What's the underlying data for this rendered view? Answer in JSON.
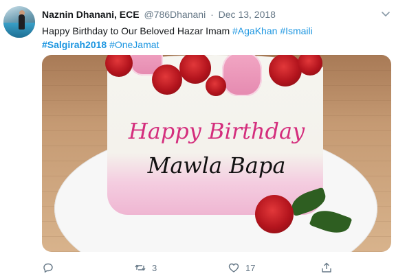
{
  "tweet": {
    "display_name": "Naznin Dhanani, ECE",
    "handle": "@786Dhanani",
    "separator": "·",
    "date": "Dec 13, 2018",
    "text_plain": "Happy Birthday to Our Beloved Hazar Imam",
    "hashtags": [
      "#AgaKhan",
      "#Ismaili",
      "#Salgirah2018",
      "#OneJamat"
    ],
    "media": {
      "cake_text_line1": "Happy Birthday",
      "cake_text_line2": "Mawla Bapa"
    },
    "actions": {
      "reply_icon": "reply-icon",
      "reply_count": "",
      "retweet_icon": "retweet-icon",
      "retweet_count": "3",
      "like_icon": "like-icon",
      "like_count": "17",
      "share_icon": "share-icon"
    },
    "more_icon": "chevron-down-icon"
  },
  "colors": {
    "link": "#1b95e0",
    "muted": "#657786",
    "text": "#14171a"
  }
}
